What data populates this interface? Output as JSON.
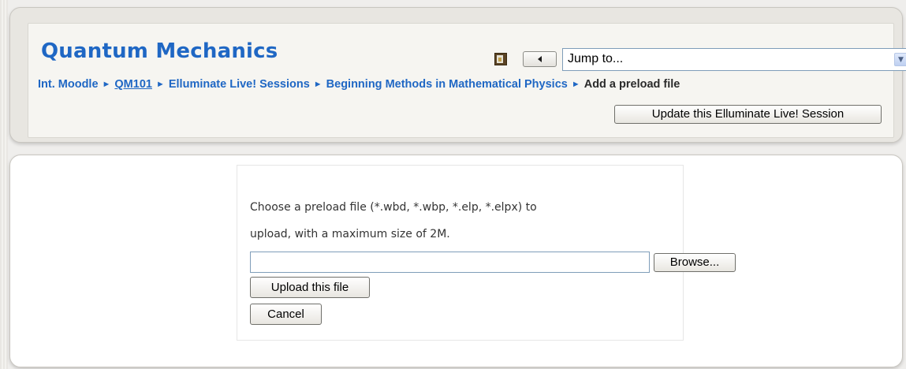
{
  "header": {
    "course_title": "Quantum Mechanics",
    "nav_icon": "course-block-icon",
    "prev_button_icon": "triangle-left-icon",
    "jump_select": {
      "value": "Jump to...",
      "arrow_icon": "chevron-down-icon"
    },
    "breadcrumb": [
      {
        "label": "Int. Moodle",
        "underlined": false
      },
      {
        "label": "QM101",
        "underlined": true
      },
      {
        "label": "Elluminate Live! Sessions",
        "underlined": false
      },
      {
        "label": "Beginning Methods in Mathematical Physics",
        "underlined": false
      }
    ],
    "breadcrumb_separator": "►",
    "breadcrumb_current": "Add a preload file",
    "update_button_label": "Update this Elluminate Live! Session"
  },
  "upload": {
    "instructions_line1": "Choose a preload file (*.wbd, *.wbp, *.elp, *.elpx) to",
    "instructions_line2": "upload, with a maximum size of 2M.",
    "file_input_value": "",
    "browse_label": "Browse...",
    "upload_label": "Upload this file",
    "cancel_label": "Cancel"
  },
  "colors": {
    "link": "#1f67c4",
    "page_background": "#efeeec"
  }
}
